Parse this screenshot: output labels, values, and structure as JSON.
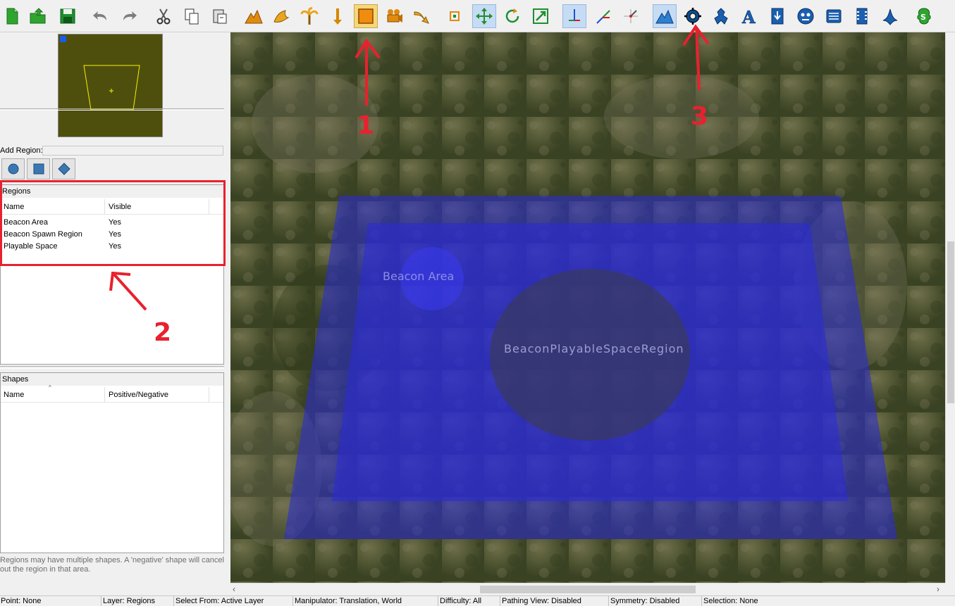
{
  "toolbar": {
    "buttons": [
      {
        "name": "new-file-icon",
        "x": 0
      },
      {
        "name": "open-file-icon",
        "x": 0
      },
      {
        "name": "save-file-icon",
        "x": 0
      },
      {
        "name": "undo-icon",
        "x": 0
      },
      {
        "name": "redo-icon",
        "x": 0
      },
      {
        "name": "cut-icon",
        "x": 0
      },
      {
        "name": "copy-icon",
        "x": 0
      },
      {
        "name": "paste-icon",
        "x": 0
      },
      {
        "name": "terrain-layer-icon"
      },
      {
        "name": "doodads-layer-icon"
      },
      {
        "name": "palm-tree-layer-icon"
      },
      {
        "name": "points-layer-icon"
      },
      {
        "name": "regions-layer-icon"
      },
      {
        "name": "cameras-layer-icon"
      },
      {
        "name": "pathing-layer-icon"
      },
      {
        "name": "select-tool-icon"
      },
      {
        "name": "move-tool-icon"
      },
      {
        "name": "rotate-tool-icon"
      },
      {
        "name": "scale-tool-icon"
      },
      {
        "name": "local-axis-icon"
      },
      {
        "name": "world-axis-icon"
      },
      {
        "name": "view-axis-icon"
      },
      {
        "name": "terrain-view-icon"
      },
      {
        "name": "data-editor-icon"
      },
      {
        "name": "unit-editor-icon"
      },
      {
        "name": "text-editor-icon"
      },
      {
        "name": "import-icon"
      },
      {
        "name": "ai-editor-icon"
      },
      {
        "name": "triggers-icon"
      },
      {
        "name": "cutscene-icon"
      },
      {
        "name": "sound-editor-icon"
      },
      {
        "name": "test-map-icon"
      }
    ]
  },
  "left": {
    "add_region_label": "Add Region:",
    "regions": {
      "title": "Regions",
      "columns": [
        "Name",
        "Visible"
      ],
      "rows": [
        {
          "name": "Beacon Area",
          "visible": "Yes"
        },
        {
          "name": "Beacon Spawn Region",
          "visible": "Yes"
        },
        {
          "name": "Playable Space",
          "visible": "Yes"
        }
      ]
    },
    "shapes": {
      "title": "Shapes",
      "columns": [
        "Name",
        "Positive/Negative"
      ]
    },
    "hint": "Regions may have multiple shapes. A 'negative' shape will cancel out the region in that area."
  },
  "viewport": {
    "labels": {
      "beacon_area": "Beacon Area",
      "overlap_label": "BeaconPlayableSpaceRegion"
    }
  },
  "status": [
    "Point: None",
    "Layer: Regions",
    "Select From: Active Layer",
    "Manipulator: Translation, World",
    "Difficulty: All",
    "Pathing View: Disabled",
    "Symmetry: Disabled",
    "Selection: None"
  ],
  "annotations": [
    "1",
    "2",
    "3"
  ],
  "colors": {
    "annotation": "#e8212e",
    "region_blue": "#2a2ad8",
    "minimap_bg": "#4f4f0d"
  }
}
